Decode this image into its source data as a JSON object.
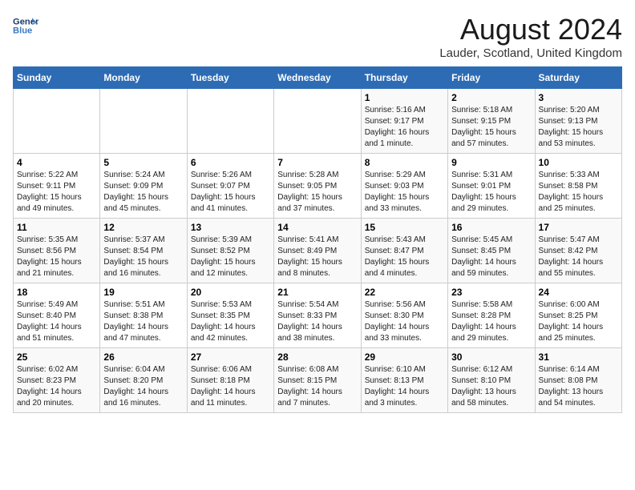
{
  "header": {
    "logo_line1": "General",
    "logo_line2": "Blue",
    "title": "August 2024",
    "subtitle": "Lauder, Scotland, United Kingdom"
  },
  "days_of_week": [
    "Sunday",
    "Monday",
    "Tuesday",
    "Wednesday",
    "Thursday",
    "Friday",
    "Saturday"
  ],
  "weeks": [
    {
      "cells": [
        {
          "day": "",
          "info": ""
        },
        {
          "day": "",
          "info": ""
        },
        {
          "day": "",
          "info": ""
        },
        {
          "day": "",
          "info": ""
        },
        {
          "day": "1",
          "info": "Sunrise: 5:16 AM\nSunset: 9:17 PM\nDaylight: 16 hours\nand 1 minute."
        },
        {
          "day": "2",
          "info": "Sunrise: 5:18 AM\nSunset: 9:15 PM\nDaylight: 15 hours\nand 57 minutes."
        },
        {
          "day": "3",
          "info": "Sunrise: 5:20 AM\nSunset: 9:13 PM\nDaylight: 15 hours\nand 53 minutes."
        }
      ]
    },
    {
      "cells": [
        {
          "day": "4",
          "info": "Sunrise: 5:22 AM\nSunset: 9:11 PM\nDaylight: 15 hours\nand 49 minutes."
        },
        {
          "day": "5",
          "info": "Sunrise: 5:24 AM\nSunset: 9:09 PM\nDaylight: 15 hours\nand 45 minutes."
        },
        {
          "day": "6",
          "info": "Sunrise: 5:26 AM\nSunset: 9:07 PM\nDaylight: 15 hours\nand 41 minutes."
        },
        {
          "day": "7",
          "info": "Sunrise: 5:28 AM\nSunset: 9:05 PM\nDaylight: 15 hours\nand 37 minutes."
        },
        {
          "day": "8",
          "info": "Sunrise: 5:29 AM\nSunset: 9:03 PM\nDaylight: 15 hours\nand 33 minutes."
        },
        {
          "day": "9",
          "info": "Sunrise: 5:31 AM\nSunset: 9:01 PM\nDaylight: 15 hours\nand 29 minutes."
        },
        {
          "day": "10",
          "info": "Sunrise: 5:33 AM\nSunset: 8:58 PM\nDaylight: 15 hours\nand 25 minutes."
        }
      ]
    },
    {
      "cells": [
        {
          "day": "11",
          "info": "Sunrise: 5:35 AM\nSunset: 8:56 PM\nDaylight: 15 hours\nand 21 minutes."
        },
        {
          "day": "12",
          "info": "Sunrise: 5:37 AM\nSunset: 8:54 PM\nDaylight: 15 hours\nand 16 minutes."
        },
        {
          "day": "13",
          "info": "Sunrise: 5:39 AM\nSunset: 8:52 PM\nDaylight: 15 hours\nand 12 minutes."
        },
        {
          "day": "14",
          "info": "Sunrise: 5:41 AM\nSunset: 8:49 PM\nDaylight: 15 hours\nand 8 minutes."
        },
        {
          "day": "15",
          "info": "Sunrise: 5:43 AM\nSunset: 8:47 PM\nDaylight: 15 hours\nand 4 minutes."
        },
        {
          "day": "16",
          "info": "Sunrise: 5:45 AM\nSunset: 8:45 PM\nDaylight: 14 hours\nand 59 minutes."
        },
        {
          "day": "17",
          "info": "Sunrise: 5:47 AM\nSunset: 8:42 PM\nDaylight: 14 hours\nand 55 minutes."
        }
      ]
    },
    {
      "cells": [
        {
          "day": "18",
          "info": "Sunrise: 5:49 AM\nSunset: 8:40 PM\nDaylight: 14 hours\nand 51 minutes."
        },
        {
          "day": "19",
          "info": "Sunrise: 5:51 AM\nSunset: 8:38 PM\nDaylight: 14 hours\nand 47 minutes."
        },
        {
          "day": "20",
          "info": "Sunrise: 5:53 AM\nSunset: 8:35 PM\nDaylight: 14 hours\nand 42 minutes."
        },
        {
          "day": "21",
          "info": "Sunrise: 5:54 AM\nSunset: 8:33 PM\nDaylight: 14 hours\nand 38 minutes."
        },
        {
          "day": "22",
          "info": "Sunrise: 5:56 AM\nSunset: 8:30 PM\nDaylight: 14 hours\nand 33 minutes."
        },
        {
          "day": "23",
          "info": "Sunrise: 5:58 AM\nSunset: 8:28 PM\nDaylight: 14 hours\nand 29 minutes."
        },
        {
          "day": "24",
          "info": "Sunrise: 6:00 AM\nSunset: 8:25 PM\nDaylight: 14 hours\nand 25 minutes."
        }
      ]
    },
    {
      "cells": [
        {
          "day": "25",
          "info": "Sunrise: 6:02 AM\nSunset: 8:23 PM\nDaylight: 14 hours\nand 20 minutes."
        },
        {
          "day": "26",
          "info": "Sunrise: 6:04 AM\nSunset: 8:20 PM\nDaylight: 14 hours\nand 16 minutes."
        },
        {
          "day": "27",
          "info": "Sunrise: 6:06 AM\nSunset: 8:18 PM\nDaylight: 14 hours\nand 11 minutes."
        },
        {
          "day": "28",
          "info": "Sunrise: 6:08 AM\nSunset: 8:15 PM\nDaylight: 14 hours\nand 7 minutes."
        },
        {
          "day": "29",
          "info": "Sunrise: 6:10 AM\nSunset: 8:13 PM\nDaylight: 14 hours\nand 3 minutes."
        },
        {
          "day": "30",
          "info": "Sunrise: 6:12 AM\nSunset: 8:10 PM\nDaylight: 13 hours\nand 58 minutes."
        },
        {
          "day": "31",
          "info": "Sunrise: 6:14 AM\nSunset: 8:08 PM\nDaylight: 13 hours\nand 54 minutes."
        }
      ]
    }
  ]
}
